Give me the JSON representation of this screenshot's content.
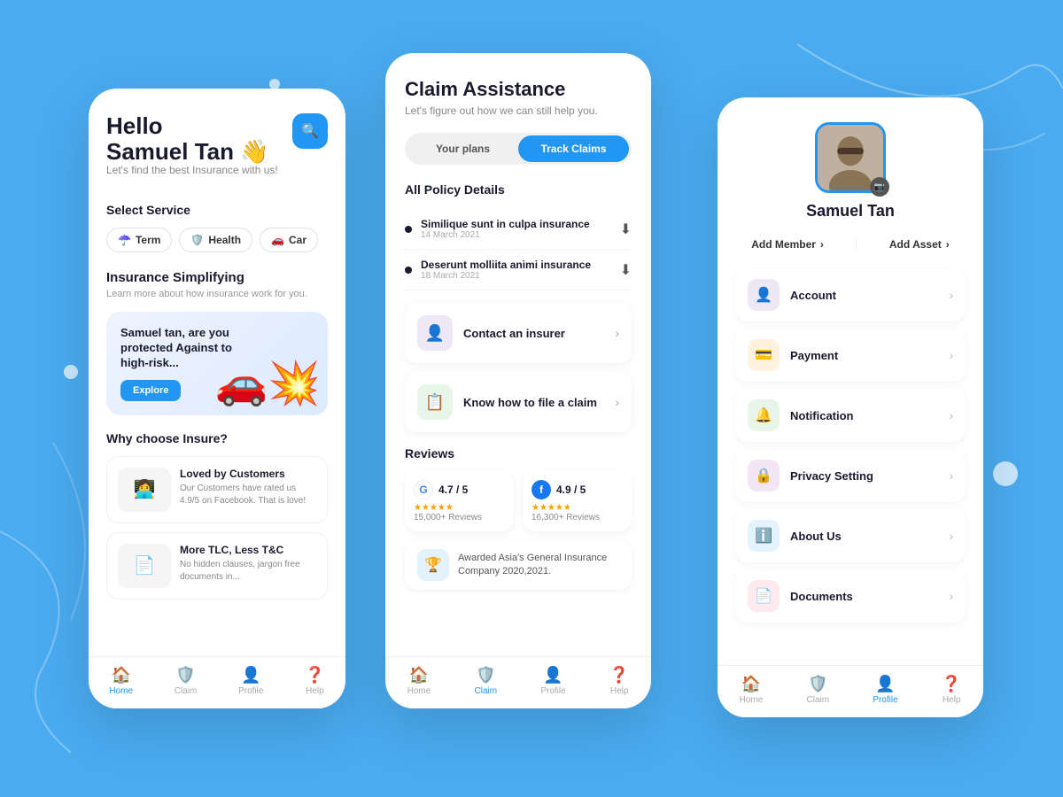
{
  "background": {
    "color": "#4AABF0"
  },
  "left_phone": {
    "greeting": "Hello\nSamuel Tan",
    "wave": "👋",
    "subtitle": "Let's find the best Insurance with us!",
    "select_service_label": "Select Service",
    "services": [
      {
        "label": "Term",
        "icon": "☂️"
      },
      {
        "label": "Health",
        "icon": "🛡️"
      },
      {
        "label": "Car",
        "icon": "🚗"
      }
    ],
    "insurance_simplify_title": "Insurance Simplifying",
    "insurance_simplify_sub": "Learn more about how insurance work for you.",
    "banner_text": "Samuel tan, are you protected Against to high-risk...",
    "explore_label": "Explore",
    "why_choose_label": "Why choose Insure?",
    "cards": [
      {
        "title": "Loved by Customers",
        "text": "Our Customers have rated us 4.9/5 on Facebook. That is love!",
        "icon": "👩‍💻"
      },
      {
        "title": "More TLC, Less T&C",
        "text": "No hidden clauses, jargon free documents in...",
        "icon": "📄"
      }
    ],
    "bottom_nav": [
      {
        "label": "Home",
        "icon": "🏠",
        "active": true
      },
      {
        "label": "Claim",
        "icon": "🛡️",
        "active": false
      },
      {
        "label": "Profile",
        "icon": "👤",
        "active": false
      },
      {
        "label": "Help",
        "icon": "❓",
        "active": false
      }
    ]
  },
  "mid_phone": {
    "title": "Claim Assistance",
    "subtitle": "Let's figure out how we can still help you.",
    "tabs": [
      {
        "label": "Your plans",
        "active": false
      },
      {
        "label": "Track Claims",
        "active": true
      }
    ],
    "track_claims_label": "Track claims",
    "policy_section_title": "All Policy Details",
    "policies": [
      {
        "name": "Similique sunt in culpa insurance",
        "date": "14 March 2021"
      },
      {
        "name": "Deserunt molliita animi insurance",
        "date": "18 March 2021"
      }
    ],
    "actions": [
      {
        "label": "Contact an insurer",
        "icon": "👤",
        "icon_bg": "purple"
      },
      {
        "label": "Know how to file a claim",
        "icon": "📋",
        "icon_bg": "green"
      }
    ],
    "reviews_title": "Reviews",
    "reviews": [
      {
        "platform": "Google",
        "score": "4.7 / 5",
        "count": "15,000+ Reviews",
        "logo_char": "G",
        "logo_type": "google"
      },
      {
        "platform": "Facebook",
        "score": "4.9 / 5",
        "count": "16,300+ Reviews",
        "logo_char": "f",
        "logo_type": "fb"
      }
    ],
    "award_text": "Awarded Asia's General Insurance Company 2020,2021.",
    "bottom_nav": [
      {
        "label": "Home",
        "icon": "🏠",
        "active": false
      },
      {
        "label": "Claim",
        "icon": "🛡️",
        "active": true
      },
      {
        "label": "Profile",
        "icon": "👤",
        "active": false
      },
      {
        "label": "Help",
        "icon": "❓",
        "active": false
      }
    ]
  },
  "right_phone": {
    "user_name": "Samuel Tan",
    "add_member_label": "Add Member",
    "add_asset_label": "Add Asset",
    "menu_items": [
      {
        "label": "Account",
        "icon": "👤",
        "icon_bg": "purple"
      },
      {
        "label": "Payment",
        "icon": "💳",
        "icon_bg": "orange"
      },
      {
        "label": "Notification",
        "icon": "🔔",
        "icon_bg": "green"
      },
      {
        "label": "Privacy Setting",
        "icon": "🔒",
        "icon_bg": "lavender"
      },
      {
        "label": "About Us",
        "icon": "ℹ️",
        "icon_bg": "blue"
      },
      {
        "label": "Documents",
        "icon": "📄",
        "icon_bg": "red"
      }
    ],
    "bottom_nav": [
      {
        "label": "Home",
        "icon": "🏠",
        "active": false
      },
      {
        "label": "Claim",
        "icon": "🛡️",
        "active": false
      },
      {
        "label": "Profile",
        "icon": "👤",
        "active": true
      },
      {
        "label": "Help",
        "icon": "❓",
        "active": false
      }
    ]
  }
}
